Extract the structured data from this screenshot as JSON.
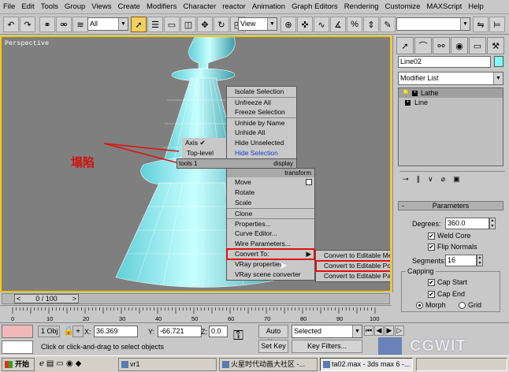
{
  "menubar": {
    "items": [
      "File",
      "Edit",
      "Tools",
      "Group",
      "Views",
      "Create",
      "Modifiers",
      "Character",
      "reactor",
      "Animation",
      "Graph Editors",
      "Rendering",
      "Customize",
      "MAXScript",
      "Help"
    ]
  },
  "toolbar": {
    "selection_filter": "All",
    "ref_coord": "View"
  },
  "viewport": {
    "label": "Perspective",
    "annotation": "塌陷"
  },
  "quad_menu": {
    "upper_left": {
      "items": [
        "Axis",
        "Top-level"
      ],
      "header": "tools 1"
    },
    "upper_right": {
      "items": [
        "Isolate Selection",
        "Unfreeze All",
        "Freeze Selection",
        "Unhide by Name",
        "Unhide All",
        "Hide Unselected",
        "Hide Selection"
      ],
      "header": "display"
    },
    "lower_right": {
      "header": "transform",
      "items": [
        "Move",
        "Rotate",
        "Scale",
        "Clone",
        "Properties...",
        "Curve Editor...",
        "Wire Parameters...",
        "Convert To:",
        "VRay properties",
        "VRay scene converter"
      ]
    },
    "submenu": {
      "items": [
        "Convert to Editable Mesh",
        "Convert to Editable Poly",
        "Convert to Editable Patch"
      ]
    }
  },
  "command_panel": {
    "object_name": "Line02",
    "modifier_list_label": "Modifier List",
    "stack": [
      "Lathe",
      "Line"
    ],
    "rollout_title": "Parameters",
    "degrees_label": "Degrees:",
    "degrees_value": "360.0",
    "weld_core": "Weld Core",
    "flip_normals": "Flip Normals",
    "segments_label": "Segments:",
    "segments_value": "16",
    "capping_label": "Capping",
    "cap_start": "Cap Start",
    "cap_end": "Cap End",
    "morph": "Morph",
    "grid": "Grid"
  },
  "timeline": {
    "frame": "0 / 100",
    "ticks": [
      "0",
      "10",
      "20",
      "30",
      "40",
      "50",
      "60",
      "70",
      "80",
      "90",
      "100"
    ]
  },
  "status": {
    "selected_count": "1 Obj",
    "x_label": "X:",
    "x_value": "36.369",
    "y_label": "Y:",
    "y_value": "-66.721",
    "z_label": "Z:",
    "z_value": "0.0",
    "prompt": "Click or click-and-drag to select objects",
    "auto_key": "Auto Key",
    "set_key": "Set Key",
    "selected_dropdown": "Selected",
    "key_filters": "Key Filters...",
    "watermark": "CGWIT"
  },
  "taskbar": {
    "start": "开始",
    "tasks": [
      "vr1",
      "火星时代动画大社区 -...",
      "ta02.max - 3ds max 6 -..."
    ]
  },
  "colors": {
    "viewport_border": "#f8c800",
    "menu_highlight": "#3050c8",
    "annotation": "#d01010",
    "object_color": "#80ffff"
  }
}
